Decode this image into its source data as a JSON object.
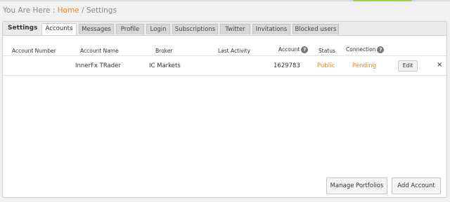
{
  "breadcrumb": {
    "prefix": "You Are Here : ",
    "home": "Home",
    "separator": " / ",
    "current": "Settings"
  },
  "panel": {
    "heading": "Settings",
    "tabs": [
      {
        "label": "Accounts",
        "active": true
      },
      {
        "label": "Messages",
        "active": false
      },
      {
        "label": "Profile",
        "active": false
      },
      {
        "label": "Login",
        "active": false
      },
      {
        "label": "Subscriptions",
        "active": false
      },
      {
        "label": "Twitter",
        "active": false
      },
      {
        "label": "Invitations",
        "active": false
      },
      {
        "label": "Blocked users",
        "active": false
      }
    ]
  },
  "table": {
    "headers": {
      "account_number": "Account Number",
      "account_name": "Account Name",
      "broker": "Broker",
      "last_activity": "Last Activity",
      "account": "Account",
      "status": "Status",
      "connection": "Connection"
    },
    "help_icon": "question-circle-icon",
    "rows": [
      {
        "account_number": "",
        "account_name": "InnerFx TRader",
        "broker": "IC Markets",
        "last_activity": "",
        "account": "1629783",
        "status": "Public",
        "connection": "Pending",
        "edit_label": "Edit",
        "remove_symbol": "×"
      }
    ]
  },
  "buttons": {
    "manage_portfolios": "Manage Portfolios",
    "add_account": "Add Account"
  },
  "colors": {
    "accent_orange": "#f0871b",
    "accent_green": "#a5cf4a"
  }
}
